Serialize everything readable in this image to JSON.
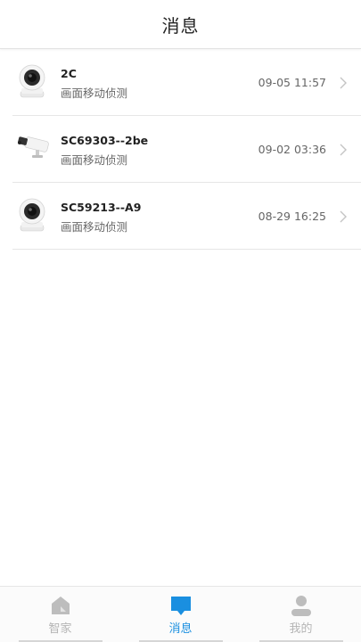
{
  "header": {
    "title": "消息"
  },
  "messages": [
    {
      "device": "2C",
      "event": "画面移动侦测",
      "time": "09-05 11:57",
      "thumbnail": "dome-camera-icon"
    },
    {
      "device": "SC69303--2be",
      "event": "画面移动侦测",
      "time": "09-02 03:36",
      "thumbnail": "bullet-camera-icon"
    },
    {
      "device": "SC59213--A9",
      "event": "画面移动侦测",
      "time": "08-29 16:25",
      "thumbnail": "dome-camera-icon"
    }
  ],
  "tabs": [
    {
      "label": "智家",
      "icon": "home-icon",
      "active": false
    },
    {
      "label": "消息",
      "icon": "message-icon",
      "active": true
    },
    {
      "label": "我的",
      "icon": "profile-icon",
      "active": false
    }
  ],
  "colors": {
    "accent": "#1a8fe0",
    "inactive": "#b5b5b5",
    "divider": "#e6e6e6"
  }
}
